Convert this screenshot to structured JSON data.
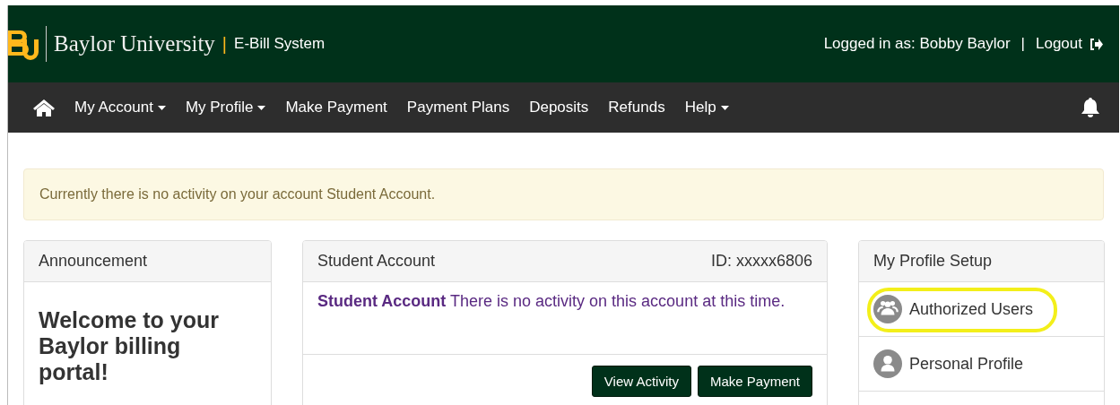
{
  "header": {
    "brand": "Baylor University",
    "brand_separator": "|",
    "system": "E-Bill System",
    "logged_in": "Logged in as: Bobby Baylor",
    "separator": "|",
    "logout": "Logout"
  },
  "nav": [
    {
      "label": "My Account",
      "dropdown": true
    },
    {
      "label": "My Profile",
      "dropdown": true
    },
    {
      "label": "Make Payment",
      "dropdown": false
    },
    {
      "label": "Payment Plans",
      "dropdown": false
    },
    {
      "label": "Deposits",
      "dropdown": false
    },
    {
      "label": "Refunds",
      "dropdown": false
    },
    {
      "label": "Help",
      "dropdown": true
    }
  ],
  "alert": "Currently there is no activity on your account Student Account.",
  "announcement": {
    "title": "Announcement",
    "heading": "Welcome to your Baylor billing portal!"
  },
  "account": {
    "title": "Student Account",
    "id": "ID: xxxxx6806",
    "message": "**Student Account** There is no activity on this account at this time.",
    "buttons": [
      "View Activity",
      "Make Payment"
    ]
  },
  "profile": {
    "title": "My Profile Setup",
    "items": [
      {
        "label": "Authorized Users",
        "kind": "users",
        "highlighted": true
      },
      {
        "label": "Personal Profile",
        "kind": "user",
        "highlighted": false
      }
    ]
  }
}
